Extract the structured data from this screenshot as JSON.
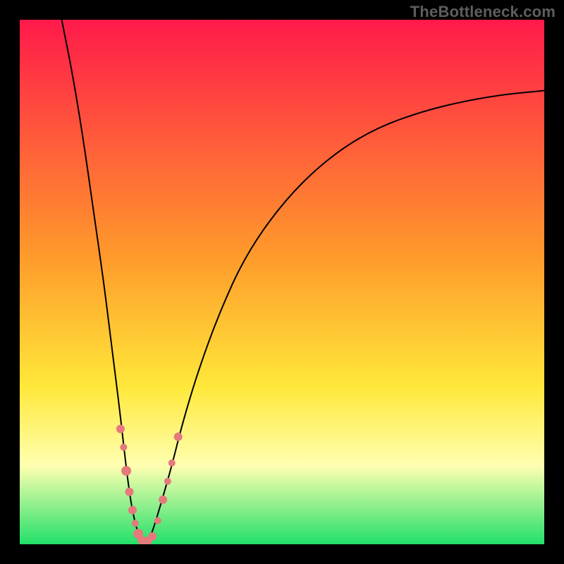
{
  "watermark": "TheBottleneck.com",
  "colors": {
    "top": "#ff1a4a",
    "orange": "#ff9a2b",
    "yellow": "#ffe83a",
    "paleyellow": "#ffffb0",
    "green": "#22e06a",
    "marker": "#e5797c",
    "curve": "#000000",
    "frame": "#000000"
  },
  "chart_data": {
    "type": "line",
    "title": "",
    "xlabel": "",
    "ylabel": "",
    "xlim": [
      0,
      100
    ],
    "ylim": [
      0,
      100
    ],
    "grid": false,
    "legend": false,
    "series": [
      {
        "name": "left-curve",
        "x": [
          8,
          10,
          12,
          14,
          16,
          17,
          18,
          19,
          19.8,
          20.5,
          21.2,
          21.8,
          22.3,
          22.8,
          23.3
        ],
        "y": [
          100,
          90,
          78,
          64,
          50,
          42,
          34,
          26,
          19,
          13,
          8,
          5,
          3,
          1.5,
          0.5
        ]
      },
      {
        "name": "right-curve",
        "x": [
          24.5,
          25.5,
          27,
          29,
          31,
          34,
          38,
          43,
          50,
          58,
          67,
          78,
          90,
          100
        ],
        "y": [
          0.5,
          3,
          8,
          15,
          23,
          33,
          44,
          55,
          65,
          73,
          79,
          83,
          85.5,
          86.5
        ]
      }
    ],
    "markers": {
      "name": "highlighted-points",
      "points": [
        {
          "x": 19.2,
          "y": 22,
          "r": 6
        },
        {
          "x": 19.8,
          "y": 18.5,
          "r": 5
        },
        {
          "x": 20.3,
          "y": 14,
          "r": 7
        },
        {
          "x": 20.9,
          "y": 10,
          "r": 6
        },
        {
          "x": 21.5,
          "y": 6.5,
          "r": 6
        },
        {
          "x": 22.0,
          "y": 4,
          "r": 5
        },
        {
          "x": 22.6,
          "y": 2,
          "r": 7
        },
        {
          "x": 23.2,
          "y": 0.8,
          "r": 6
        },
        {
          "x": 24.2,
          "y": 0.5,
          "r": 7
        },
        {
          "x": 25.3,
          "y": 1.5,
          "r": 6
        },
        {
          "x": 26.3,
          "y": 4.5,
          "r": 5
        },
        {
          "x": 27.3,
          "y": 8.5,
          "r": 6
        },
        {
          "x": 28.2,
          "y": 12,
          "r": 5
        },
        {
          "x": 29.0,
          "y": 15.5,
          "r": 5
        },
        {
          "x": 30.2,
          "y": 20.5,
          "r": 6
        }
      ]
    }
  }
}
